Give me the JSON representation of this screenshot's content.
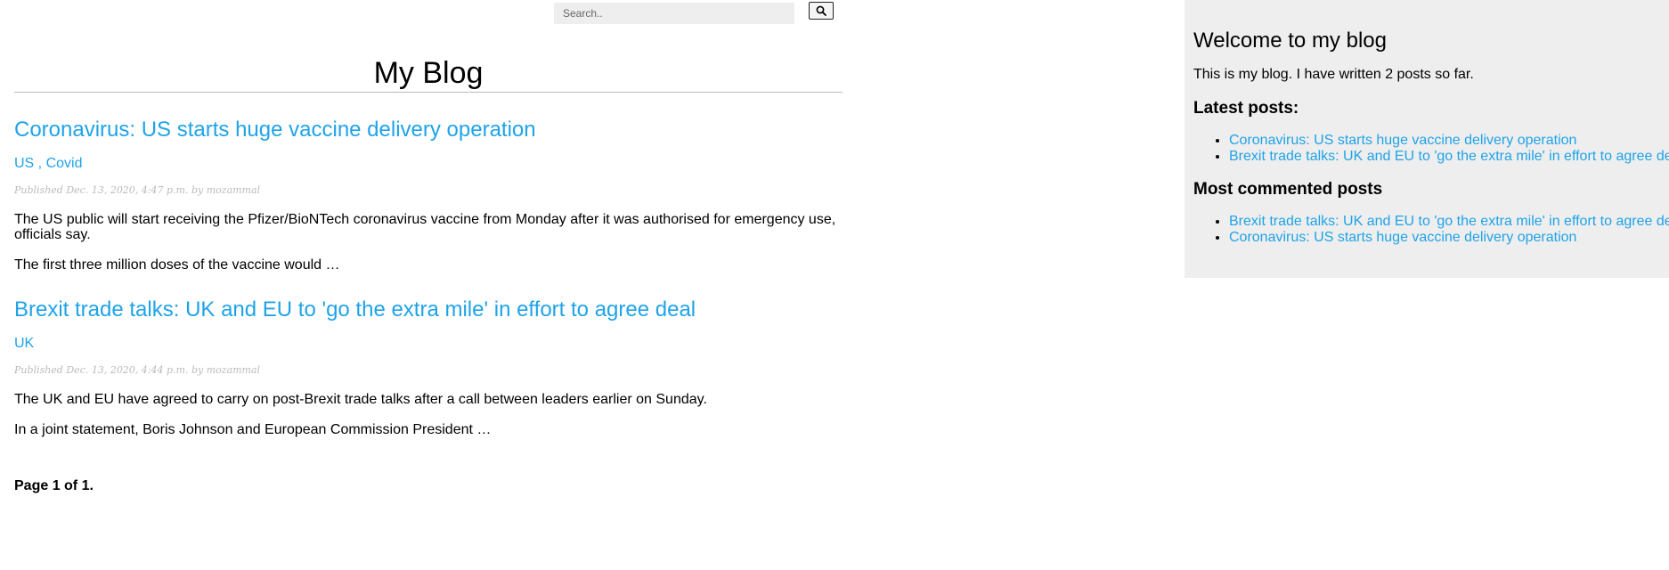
{
  "search": {
    "placeholder": "Search.."
  },
  "header": {
    "title": "My Blog"
  },
  "posts": [
    {
      "title": "Coronavirus: US starts huge vaccine delivery operation",
      "tags": [
        "US",
        "Covid"
      ],
      "tag_separator": " , ",
      "meta": "Published Dec. 13, 2020, 4:47 p.m. by mozammal",
      "paragraphs": [
        "The US public will start receiving the Pfizer/BioNTech coronavirus vaccine from Monday after it was authorised for emergency use, officials say.",
        "The first three million doses of the vaccine would …"
      ]
    },
    {
      "title": "Brexit trade talks: UK and EU to 'go the extra mile' in effort to agree deal",
      "tags": [
        "UK"
      ],
      "meta": "Published Dec. 13, 2020, 4:44 p.m. by mozammal",
      "paragraphs": [
        "The UK and EU have agreed to carry on post-Brexit trade talks after a call between leaders earlier on Sunday.",
        "In a joint statement, Boris Johnson and European Commission President …"
      ]
    }
  ],
  "pagination": {
    "text": "Page 1 of 1."
  },
  "sidebar": {
    "title": "Welcome to my blog",
    "intro": "This is my blog. I have written 2 posts so far.",
    "latest_heading": "Latest posts:",
    "latest": [
      "Coronavirus: US starts huge vaccine delivery operation",
      "Brexit trade talks: UK and EU to 'go the extra mile' in effort to agree deal"
    ],
    "commented_heading": "Most commented posts",
    "commented": [
      "Brexit trade talks: UK and EU to 'go the extra mile' in effort to agree deal",
      "Coronavirus: US starts huge vaccine delivery operation"
    ]
  },
  "colors": {
    "link": "#1fa3e8",
    "sidebar_bg": "#eeeeee",
    "meta": "#bbbbbb"
  },
  "icons": {
    "search_button": "search-icon"
  }
}
